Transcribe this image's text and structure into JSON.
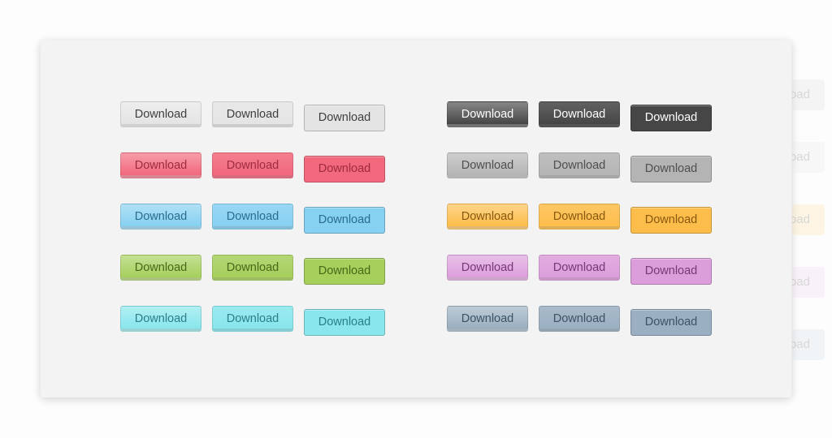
{
  "label": "Download",
  "left_group": [
    {
      "name": "gray",
      "bg": "#e4e4e4",
      "text": "#3f3f3f"
    },
    {
      "name": "pink",
      "bg": "#f2687c",
      "text": "#9e2c3e"
    },
    {
      "name": "blue",
      "bg": "#86d0f1",
      "text": "#2a6d90"
    },
    {
      "name": "green",
      "bg": "#a6cf5c",
      "text": "#476819"
    },
    {
      "name": "cyan",
      "bg": "#88e6ec",
      "text": "#2b7f88"
    }
  ],
  "right_group": [
    {
      "name": "dark",
      "bg": "#464646",
      "text": "#ffffff"
    },
    {
      "name": "silver",
      "bg": "#b4b4b4",
      "text": "#4f4f4f"
    },
    {
      "name": "orange",
      "bg": "#fdbd4a",
      "text": "#875810"
    },
    {
      "name": "purple",
      "bg": "#dc9edb",
      "text": "#773877"
    },
    {
      "name": "steel",
      "bg": "#9aafc1",
      "text": "#3d5365"
    }
  ],
  "ghost_colors": [
    "#d8d8d8",
    "#e4e4e4",
    "#fdd88a",
    "#ecc8ec",
    "#c8d6e4"
  ]
}
